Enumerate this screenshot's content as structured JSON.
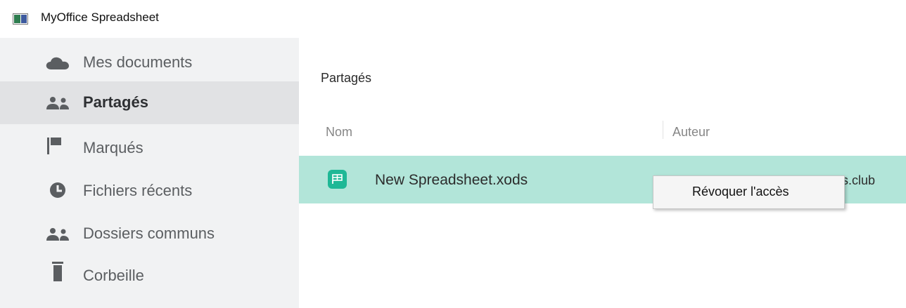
{
  "window": {
    "title": "MyOffice Spreadsheet",
    "icon": "app-icon"
  },
  "sidebar": {
    "items": [
      {
        "label": "Mes documents",
        "icon": "cloud-icon",
        "active": false
      },
      {
        "label": "Partagés",
        "icon": "people-icon",
        "active": true
      },
      {
        "label": "Marqués",
        "icon": "flag-icon",
        "active": false
      },
      {
        "label": "Fichiers récents",
        "icon": "clock-icon",
        "active": false
      },
      {
        "label": "Dossiers communs",
        "icon": "people-icon",
        "active": false
      },
      {
        "label": "Corbeille",
        "icon": "trash-icon",
        "active": false
      }
    ]
  },
  "main": {
    "section_title": "Partagés",
    "columns": [
      "Nom",
      "Auteur"
    ],
    "files": [
      {
        "name": "New Spreadsheet.xods",
        "author_visible": "s.club",
        "icon": "spreadsheet-file-icon",
        "selected": true
      }
    ]
  },
  "context_menu": {
    "items": [
      {
        "label": "Révoquer l'accès"
      }
    ]
  },
  "colors": {
    "sidebar_bg": "#f1f2f3",
    "sidebar_active": "#e1e2e4",
    "selected_row": "#b2e5d9",
    "file_icon": "#1fb896"
  }
}
